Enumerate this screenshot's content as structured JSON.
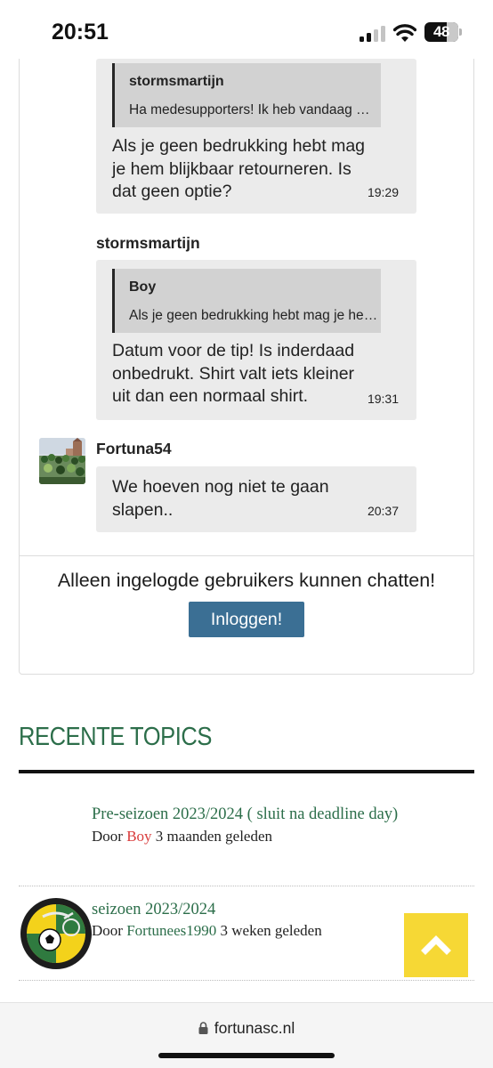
{
  "status_bar": {
    "time": "20:51",
    "battery_level": "48",
    "icons": [
      "signal-icon",
      "wifi-icon",
      "battery-icon"
    ]
  },
  "chat": {
    "messages": [
      {
        "quote": {
          "author": "stormsmartijn",
          "text": "Ha medesupporters! Ik heb vandaag mijn shirt ontvangen"
        },
        "lines": [
          "Als je geen bedrukking hebt mag",
          "je hem blijkbaar retourneren. Is",
          "dat geen optie?"
        ],
        "time": "19:29"
      },
      {
        "author": "stormsmartijn",
        "quote": {
          "author": "Boy",
          "text": "Als je geen bedrukking hebt mag je hem blijkbaar retourneren"
        },
        "lines": [
          "Datum voor de tip! Is inderdaad",
          "onbedrukt. Shirt valt iets kleiner",
          "uit dan een normaal shirt."
        ],
        "time": "19:31"
      },
      {
        "author": "Fortuna54",
        "lines": [
          "We hoeven nog niet te gaan",
          "slapen.."
        ],
        "time": "20:37"
      }
    ],
    "login_note": "Alleen ingelogde gebruikers kunnen chatten!",
    "login_button": "Inloggen!"
  },
  "recent_topics": {
    "heading": "RECENTE TOPICS",
    "topics": [
      {
        "title": "Pre-seizoen 2023/2024 ( sluit na deadline day)",
        "by_prefix": "Door",
        "user": "Boy",
        "when": "3 maanden geleden"
      },
      {
        "title": "seizoen 2023/2024",
        "by_prefix": "Door",
        "user": "Fortunees1990",
        "when": "3 weken geleden"
      }
    ]
  },
  "colors": {
    "accent_green": "#2c6e4a",
    "login_blue": "#3b6f94",
    "scroll_yellow": "#f6d835",
    "user_red": "#d93b3b",
    "bubble_gray": "#ebebeb"
  },
  "browser": {
    "url": "fortunasc.nl"
  }
}
